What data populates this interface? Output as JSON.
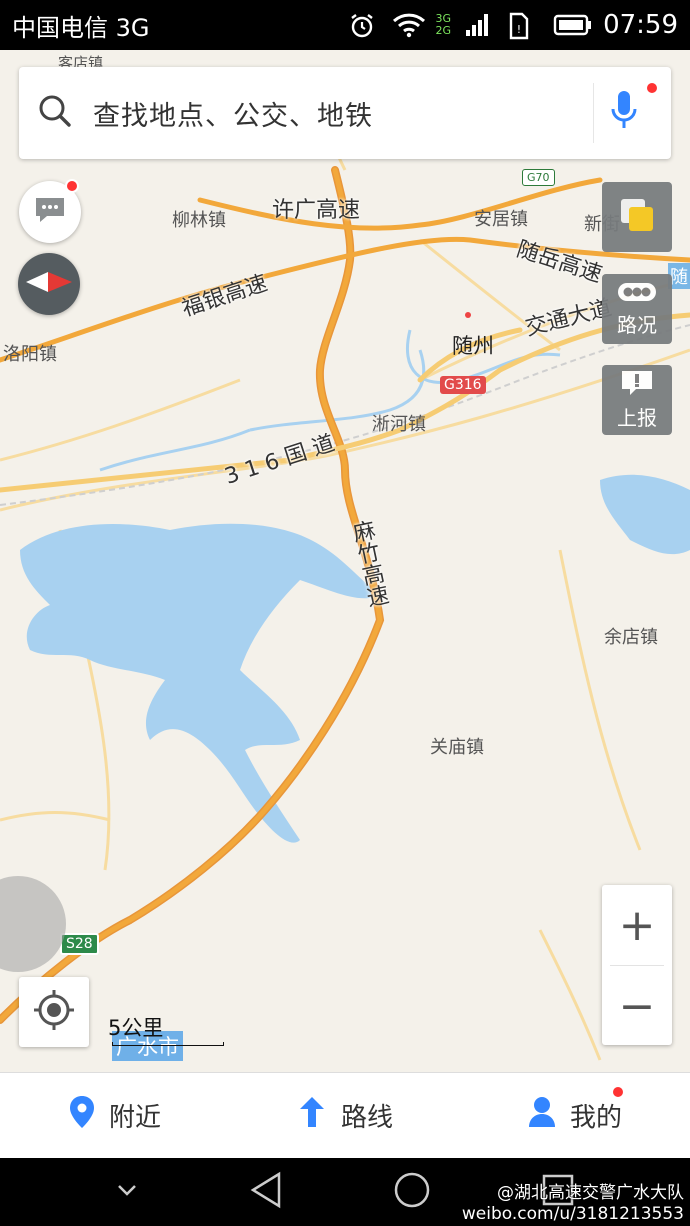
{
  "status_bar": {
    "carrier": "中国电信 3G",
    "net_top": "3G",
    "net_bottom": "2G",
    "time": "07:59"
  },
  "search": {
    "placeholder": "查找地点、公交、地铁"
  },
  "side_buttons": {
    "traffic_label": "路况",
    "report_label": "上报"
  },
  "map": {
    "places": {
      "kedianzhen": "客店镇",
      "liulinzhen": "柳林镇",
      "andianzhen": "安居镇",
      "xinjie": "新街",
      "luoyangzhen": "洛阳镇",
      "suizhou": "随州",
      "xiheszhen": "淅河镇",
      "yudianzhen": "余店镇",
      "guanmiaozhen": "关庙镇",
      "sui_edge": "随"
    },
    "roads": {
      "xuguang": "许广高速",
      "suiyue": "随岳高速",
      "fuyin": "福银高速",
      "jiaotong": "交通大道",
      "g316_text": "3 1 6 国 道",
      "mazhu": "麻竹高速"
    },
    "shields": {
      "g70": "G70",
      "g316": "G316",
      "s28": "S28"
    },
    "scale_text": "5公里",
    "city_label": "广水市"
  },
  "zoom": {
    "in_label": "+",
    "out_label": "−"
  },
  "bottom_nav": [
    {
      "label": "附近",
      "icon": "location-pin-icon"
    },
    {
      "label": "路线",
      "icon": "route-arrow-icon"
    },
    {
      "label": "我的",
      "icon": "person-icon"
    }
  ],
  "watermark": {
    "line1": "@湖北高速交警广水大队",
    "line2": "weibo.com/u/3181213553"
  },
  "colors": {
    "water": "#a8d1f0",
    "highway": "#f2a83b",
    "road": "#f6cc73",
    "accent": "#3385ff",
    "badge": "#f33"
  }
}
